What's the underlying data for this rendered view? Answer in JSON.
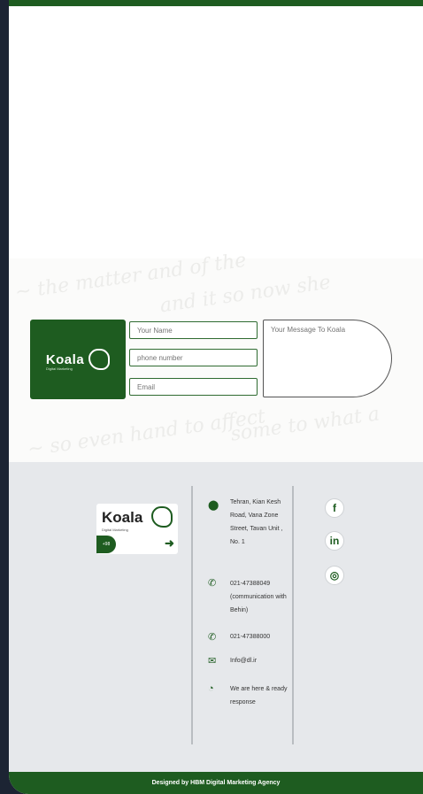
{
  "contact": {
    "brand_name": "Koala",
    "brand_tagline": "Digital Marketing",
    "name_placeholder": "Your Name",
    "phone_placeholder": "phone number",
    "email_placeholder": "Email",
    "message_placeholder": "Your Message To Koala"
  },
  "footer": {
    "logo_text": "Koala",
    "logo_sub": "Digital Marketing",
    "logo_pill": "+98",
    "address": "Tehran, Kian Kesh Road, Vana Zone Street, Tavan Unit , No. 1",
    "phone_1": "021-47388049 (communication with Behin)",
    "phone_2": "021-47388000",
    "email": "Info@dl.ir",
    "response": "We are here & ready response"
  },
  "social": {
    "facebook": "f",
    "linkedin": "in",
    "instagram": "◎"
  },
  "bottom": {
    "credit": "Designed by HBM Digital Marketing Agency"
  },
  "colors": {
    "brand_green": "#1e5c20",
    "footer_bg": "#e6e8eb",
    "page_bg": "#1c2433"
  },
  "icons": [
    "location-icon",
    "phone-icon",
    "phone-icon",
    "mail-icon",
    "chat-icon"
  ]
}
